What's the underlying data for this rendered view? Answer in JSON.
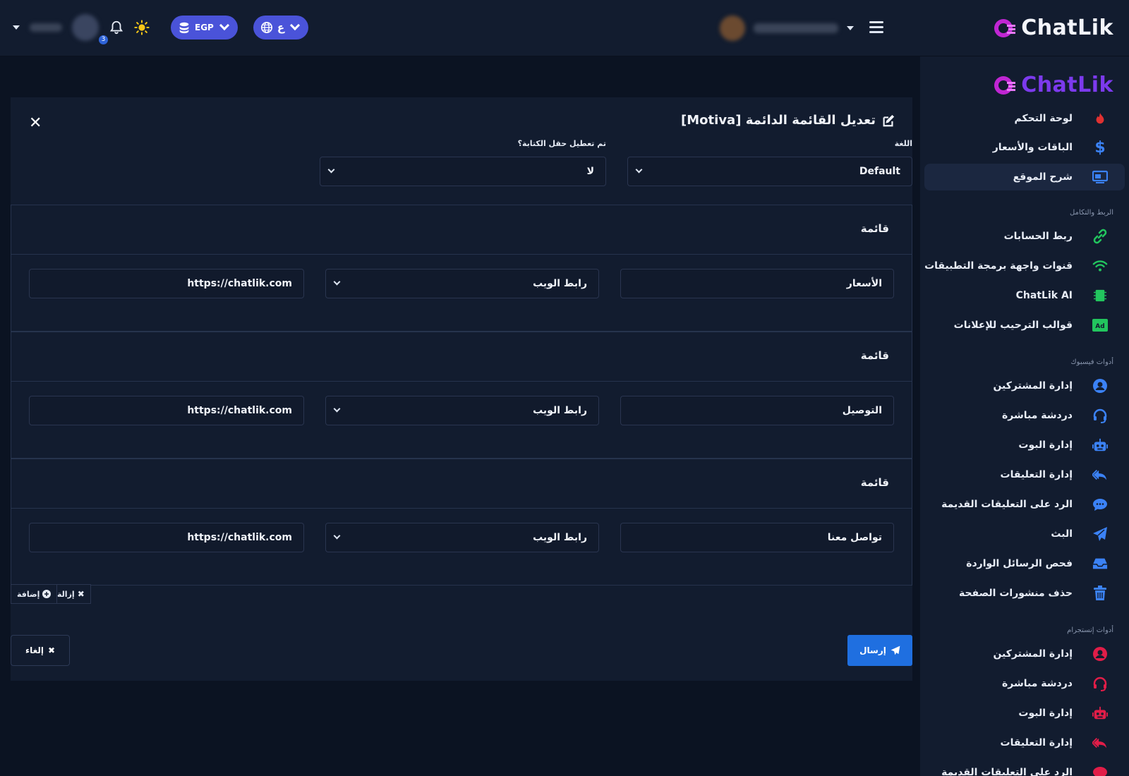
{
  "brand": {
    "name": "ChatLik",
    "accent": "#7c3aed"
  },
  "topbar": {
    "currency": "EGP",
    "language": "ع",
    "notification_count": "3"
  },
  "sidebar": {
    "items": [
      {
        "label": "لوحة التحكم",
        "icon": "flame-icon"
      },
      {
        "label": "الباقات والأسعار",
        "icon": "dollar-icon"
      },
      {
        "label": "شرح الموقع",
        "icon": "screen-icon"
      }
    ],
    "section_integration": "الربط والتكامل",
    "integration_items": [
      {
        "label": "ربط الحسابات",
        "icon": "link-icon"
      },
      {
        "label": "قنوات واجهة برمجة التطبيقات",
        "icon": "wifi-icon"
      },
      {
        "label": "ChatLik AI",
        "icon": "chip-icon"
      },
      {
        "label": "قوالب الترحيب للإعلانات",
        "icon": "ad-icon"
      }
    ],
    "section_facebook": "أدوات فيسبوك",
    "facebook_items": [
      {
        "label": "إدارة المشتركين",
        "icon": "user-icon"
      },
      {
        "label": "دردشة مباشرة",
        "icon": "headset-icon"
      },
      {
        "label": "إدارة البوت",
        "icon": "robot-icon"
      },
      {
        "label": "إدارة التعليقات",
        "icon": "reply-all-icon"
      },
      {
        "label": "الرد على التعليقات القديمة",
        "icon": "comment-icon"
      },
      {
        "label": "البث",
        "icon": "send-icon"
      },
      {
        "label": "فحص الرسائل الواردة",
        "icon": "inbox-icon"
      },
      {
        "label": "حذف منشورات الصفحة",
        "icon": "trash-icon"
      }
    ],
    "section_instagram": "أدوات إنستجرام",
    "instagram_items": [
      {
        "label": "إدارة المشتركين",
        "icon": "user-icon"
      },
      {
        "label": "دردشة مباشرة",
        "icon": "headset-icon"
      },
      {
        "label": "إدارة البوت",
        "icon": "robot-icon"
      },
      {
        "label": "إدارة التعليقات",
        "icon": "reply-all-icon"
      },
      {
        "label": "الرد على التعليقات القديمة",
        "icon": "comment-icon"
      }
    ]
  },
  "form": {
    "title": "تعديل القائمة الدائمة [Motiva]",
    "language_label": "اللغة",
    "language_value": "Default",
    "composer_label": "تم تعطيل حقل الكتابة؟",
    "composer_value": "لا",
    "menus": [
      {
        "heading": "قائمة",
        "title": "الأسعار",
        "type": "رابط الويب",
        "url": "https://chatlik.com"
      },
      {
        "heading": "قائمة",
        "title": "التوصيل",
        "type": "رابط الويب",
        "url": "https://chatlik.com"
      },
      {
        "heading": "قائمة",
        "title": "تواصل معنا",
        "type": "رابط الويب",
        "url": "https://chatlik.com"
      }
    ],
    "remove_label": "إزالة",
    "add_label": "إضافة",
    "send_label": "إرسال",
    "cancel_label": "إلغاء"
  }
}
